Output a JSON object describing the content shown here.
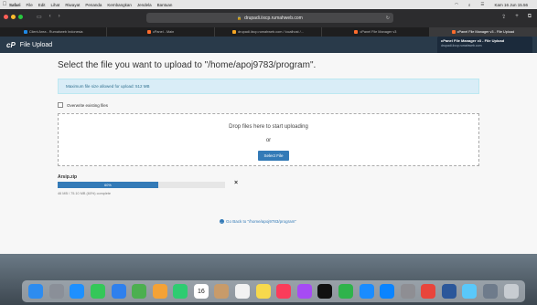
{
  "menubar": {
    "apple": "",
    "app": "Safari",
    "items": [
      "File",
      "Edit",
      "Lihat",
      "Riwayat",
      "Penanda",
      "Kembangkan",
      "Jendela",
      "Bantuan"
    ],
    "clock": "Kam 16 Jun  15.56"
  },
  "browser": {
    "address": "drupadi.iixcp.rumahweb.com",
    "tabs": [
      {
        "label": "Client Area - Rumahweb Indonesia",
        "color": "#1e88e5"
      },
      {
        "label": "cPanel - Main",
        "color": "#ff6c2c"
      },
      {
        "label": "drupadi.iixcp.rumahweb.com / localhost /...",
        "color": "#f5a623"
      },
      {
        "label": "cPanel File Manager v3",
        "color": "#ff6c2c"
      },
      {
        "label": "cPanel File Manager v3 - File Upload",
        "color": "#ff6c2c"
      }
    ],
    "tooltip_title": "cPanel File Manager v3 - File Upload",
    "tooltip_url": "drupadi.iixcp.rumahweb.com"
  },
  "header": {
    "logo": "cP",
    "title": "File Upload"
  },
  "upload": {
    "heading": "Select the file you want to upload to \"/home/apoj9783/program\".",
    "max_size": "Maximum file size allowed for upload: 512 MB",
    "overwrite_label": "Overwrite existing files",
    "drop_text": "Drop files here to start uploading",
    "or_text": "or",
    "select_button": "Select File",
    "file_name": "Arsip.zip",
    "progress_percent": 60,
    "progress_label": "60%",
    "progress_status": "46 MB / 75.10 MB (60%) complete",
    "cancel": "×",
    "go_back": "Go Back to \"/home/apoj9783/program\""
  },
  "dock": {
    "apps": [
      {
        "name": "finder",
        "color": "#2d8cf0"
      },
      {
        "name": "launchpad",
        "color": "#8a8f98"
      },
      {
        "name": "safari",
        "color": "#1e90ff"
      },
      {
        "name": "messages",
        "color": "#34c759"
      },
      {
        "name": "mail",
        "color": "#2f80ed"
      },
      {
        "name": "maps",
        "color": "#4caf50"
      },
      {
        "name": "photos",
        "color": "#f4a236"
      },
      {
        "name": "facetime",
        "color": "#2ecc71"
      },
      {
        "name": "calendar",
        "color": "#ffffff"
      },
      {
        "name": "contacts",
        "color": "#c89b6a"
      },
      {
        "name": "reminders",
        "color": "#f2f2f2"
      },
      {
        "name": "notes",
        "color": "#f7d94c"
      },
      {
        "name": "music",
        "color": "#fa3c5a"
      },
      {
        "name": "podcasts",
        "color": "#a64bf4"
      },
      {
        "name": "tv",
        "color": "#111111"
      },
      {
        "name": "numbers",
        "color": "#2fb34b"
      },
      {
        "name": "keynote",
        "color": "#1a8cff"
      },
      {
        "name": "appstore",
        "color": "#0a84ff"
      },
      {
        "name": "settings",
        "color": "#8e8e93"
      },
      {
        "name": "chrome",
        "color": "#e8453c"
      },
      {
        "name": "word",
        "color": "#2b579a"
      },
      {
        "name": "finder2",
        "color": "#5ac8fa"
      },
      {
        "name": "preview",
        "color": "#6e7b8b"
      },
      {
        "name": "trash",
        "color": "#c7ccd1"
      }
    ],
    "calendar_day": "16"
  }
}
